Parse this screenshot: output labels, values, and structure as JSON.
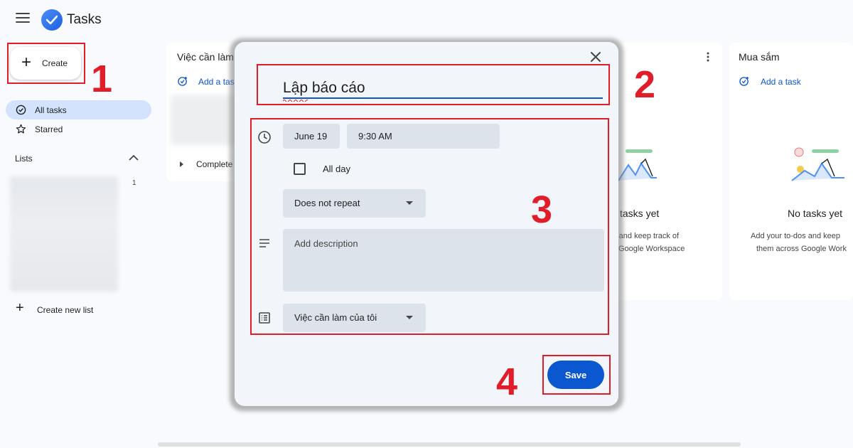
{
  "app": {
    "title": "Tasks",
    "accent": "#0b57d0"
  },
  "sidebar": {
    "create_label": "Create",
    "nav": [
      {
        "label": "All tasks",
        "icon": "check-circle-icon",
        "active": true
      },
      {
        "label": "Starred",
        "icon": "star-icon",
        "active": false
      }
    ],
    "lists_heading": "Lists",
    "list_count": "1",
    "create_list_label": "Create new list"
  },
  "columns": [
    {
      "title": "Việc cần làm",
      "add_task": "Add a task",
      "completed": "Complete"
    },
    {
      "empty_title": "tasks yet",
      "empty_line1": "os and keep track of",
      "empty_line2": "Google Workspace"
    },
    {
      "title": "Mua sắm",
      "add_task": "Add a task",
      "empty_title": "No tasks yet",
      "empty_line1": "Add your to-dos and keep",
      "empty_line2": "them across Google Work"
    }
  ],
  "dialog": {
    "title_value": "Lập báo cáo",
    "date": "June 19",
    "time": "9:30 AM",
    "all_day_label": "All day",
    "repeat": "Does not repeat",
    "description_placeholder": "Add description",
    "list": "Việc cần làm của tôi",
    "save_label": "Save"
  },
  "annotations": {
    "step1": "1",
    "step2": "2",
    "step3": "3",
    "step4": "4",
    "color": "#e21d2a"
  }
}
